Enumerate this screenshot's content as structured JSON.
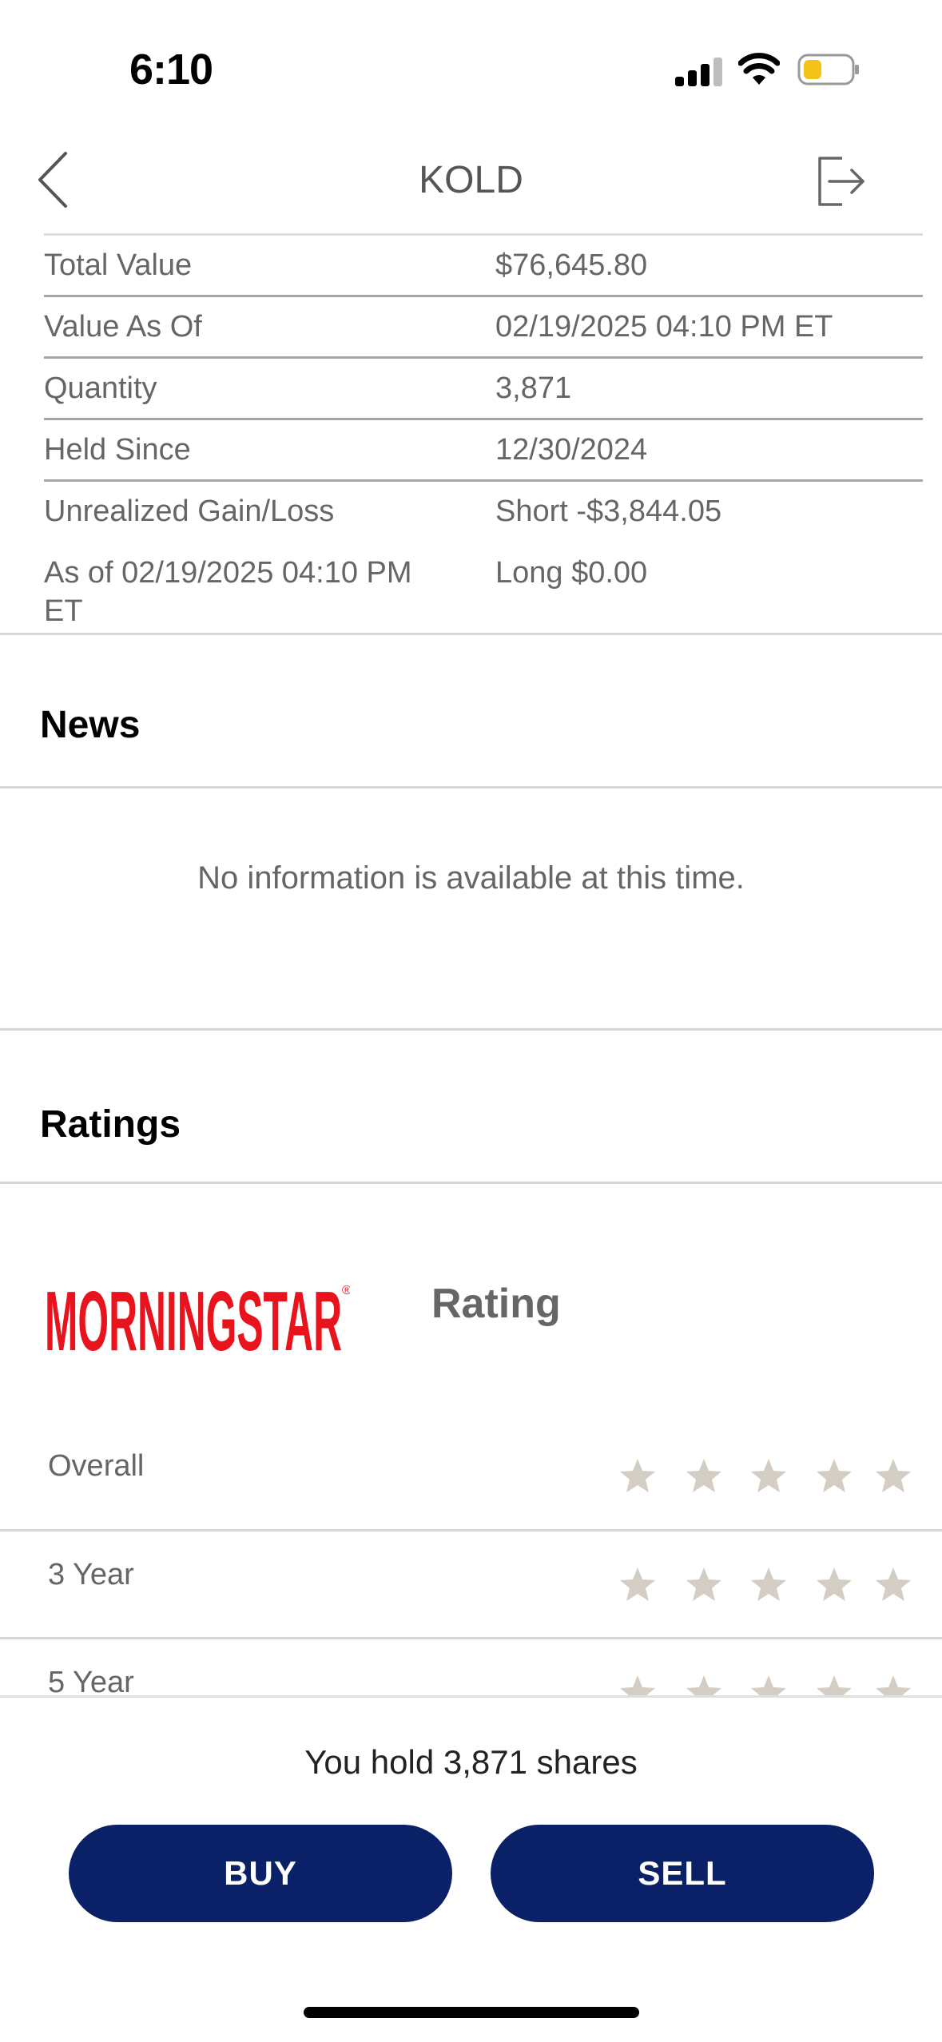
{
  "status_bar": {
    "time": "6:10"
  },
  "nav": {
    "title": "KOLD"
  },
  "details": [
    {
      "label": "Total Value",
      "value": "$76,645.80"
    },
    {
      "label": "Value As Of",
      "value": "02/19/2025 04:10 PM ET"
    },
    {
      "label": "Quantity",
      "value": "3,871"
    },
    {
      "label": "Held Since",
      "value": "12/30/2024"
    },
    {
      "label": "Unrealized Gain/Loss",
      "value": "Short -$3,844.05"
    },
    {
      "label": "As of 02/19/2025 04:10 PM ET",
      "value": "Long $0.00"
    }
  ],
  "news": {
    "title": "News",
    "empty_message": "No information is available at this time."
  },
  "ratings": {
    "title": "Ratings",
    "logo_text": "MORNINGSTAR",
    "rating_heading": "Rating",
    "rows": [
      {
        "label": "Overall",
        "stars_filled": 0,
        "stars_total": 5
      },
      {
        "label": "3 Year",
        "stars_filled": 0,
        "stars_total": 5
      },
      {
        "label": "5 Year",
        "stars_filled": 0,
        "stars_total": 5
      }
    ]
  },
  "colors": {
    "primary_button": "#0a2167",
    "star_empty": "#d4cdc4",
    "logo_red": "#e8131d"
  },
  "bottom": {
    "hold_text": "You hold 3,871 shares",
    "buy_label": "BUY",
    "sell_label": "SELL"
  }
}
